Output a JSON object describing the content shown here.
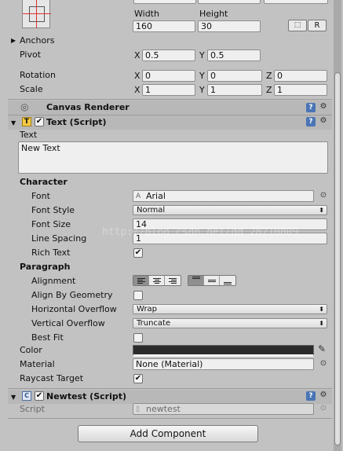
{
  "rect": {
    "width_label": "Width",
    "height_label": "Height",
    "width_value": "160",
    "height_value": "30",
    "blueprint_btn": "⬚",
    "raw_btn": "R"
  },
  "anchors_label": "Anchors",
  "pivot": {
    "label": "Pivot",
    "x_axis": "X",
    "x": "0.5",
    "y_axis": "Y",
    "y": "0.5"
  },
  "rotation": {
    "label": "Rotation",
    "x_axis": "X",
    "x": "0",
    "y_axis": "Y",
    "y": "0",
    "z_axis": "Z",
    "z": "0"
  },
  "scale": {
    "label": "Scale",
    "x_axis": "X",
    "x": "1",
    "y_axis": "Y",
    "y": "1",
    "z_axis": "Z",
    "z": "1"
  },
  "canvas_renderer": {
    "title": "Canvas Renderer"
  },
  "text_script": {
    "title": "Text (Script)",
    "text_label": "Text",
    "text_value": "New Text",
    "character_header": "Character",
    "font_label": "Font",
    "font_value": "Arial",
    "font_style_label": "Font Style",
    "font_style_value": "Normal",
    "font_size_label": "Font Size",
    "font_size_value": "14",
    "line_spacing_label": "Line Spacing",
    "line_spacing_value": "1",
    "rich_text_label": "Rich Text",
    "rich_text_checked": true,
    "paragraph_header": "Paragraph",
    "alignment_label": "Alignment",
    "align_by_geometry_label": "Align By Geometry",
    "horizontal_overflow_label": "Horizontal Overflow",
    "horizontal_overflow_value": "Wrap",
    "vertical_overflow_label": "Vertical Overflow",
    "vertical_overflow_value": "Truncate",
    "best_fit_label": "Best Fit",
    "color_label": "Color",
    "color_value": "#2b2b2b",
    "material_label": "Material",
    "material_value": "None (Material)",
    "raycast_label": "Raycast Target"
  },
  "newtest_script": {
    "title": "Newtest (Script)",
    "script_label": "Script",
    "script_value": "newtest"
  },
  "add_component_label": "Add Component",
  "watermark": "http://blog.csdn.net/qq_28210809"
}
